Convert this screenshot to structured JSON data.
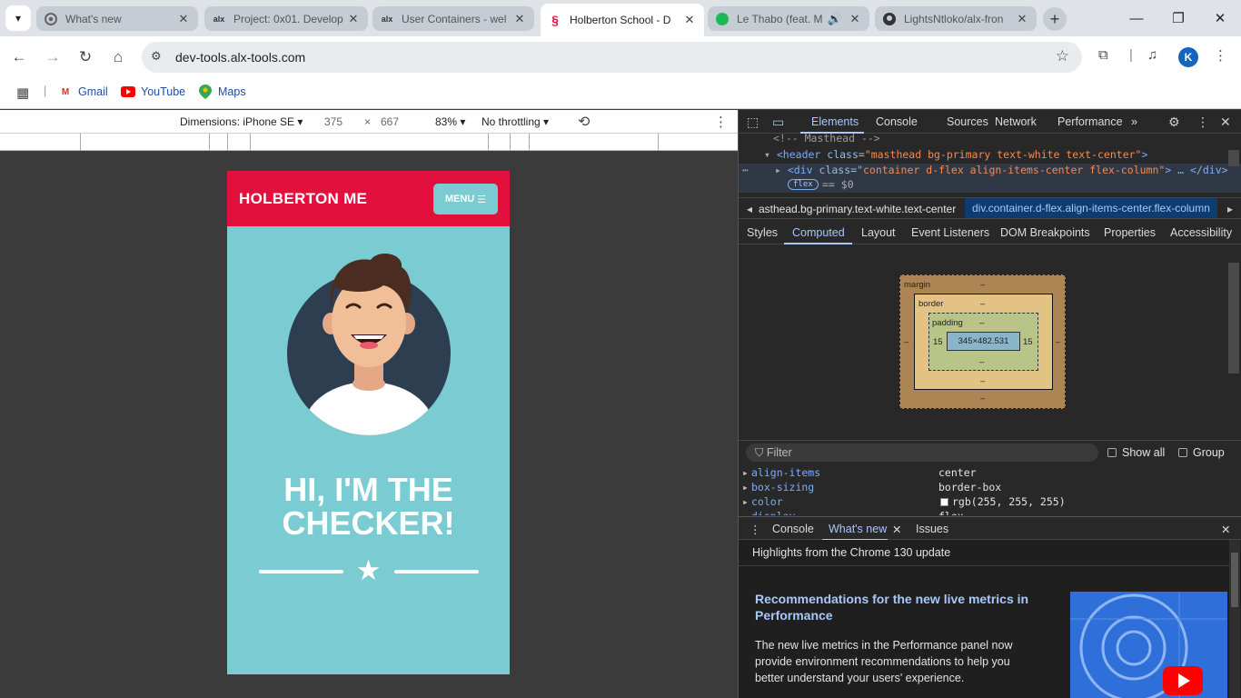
{
  "browser": {
    "tabs": [
      {
        "title": "What's new",
        "favicon": "chrome-icon",
        "active": false
      },
      {
        "title": "Project: 0x01. Develop",
        "favicon": "alx-icon",
        "active": false
      },
      {
        "title": "User Containers - wel",
        "favicon": "alx-icon",
        "active": false
      },
      {
        "title": "Holberton School - D",
        "favicon": "holberton-icon",
        "active": true
      },
      {
        "title": "Le Thabo (feat. M",
        "favicon": "spotify-icon",
        "active": false
      },
      {
        "title": "LightsNtloko/alx-fron",
        "favicon": "github-icon",
        "active": false
      }
    ],
    "close_glyph": "✕",
    "new_tab_glyph": "+",
    "url": "dev-tools.alx-tools.com",
    "bookmarks": [
      {
        "label": "Gmail",
        "icon": "gmail-icon"
      },
      {
        "label": "YouTube",
        "icon": "youtube-icon"
      },
      {
        "label": "Maps",
        "icon": "maps-icon"
      }
    ],
    "profile_initial": "K"
  },
  "device_toolbar": {
    "dimensions_label": "Dimensions: iPhone SE",
    "width": "375",
    "times": "×",
    "height": "667",
    "zoom": "83%",
    "throttling": "No throttling"
  },
  "page": {
    "brand": "HOLBERTON ME",
    "menu_label": "MENU",
    "hero_line1": "HI, I'M THE",
    "hero_line2": "CHECKER!",
    "colors": {
      "primary": "#e3103e",
      "secondary": "#7acbd2"
    }
  },
  "devtools": {
    "tabs": [
      "Elements",
      "Console",
      "Sources",
      "Network",
      "Performance"
    ],
    "active_tab": "Elements",
    "more_tabs_glyph": "»",
    "code": {
      "comment": "<!-- Masthead -->",
      "header_tag": "<header",
      "header_attr": "class=",
      "header_val": "\"masthead bg-primary text-white text-center\"",
      "header_close": ">",
      "div_tag": "<div",
      "div_attr": "class=",
      "div_val": "\"container d-flex align-items-center flex-column\"",
      "div_close": "> … </div>",
      "flex_badge": "flex",
      "dollar": "== $0"
    },
    "breadcrumbs": [
      "asthead.bg-primary.text-white.text-center",
      "div.container.d-flex.align-items-center.flex-column"
    ],
    "subtabs": [
      "Styles",
      "Computed",
      "Layout",
      "Event Listeners",
      "DOM Breakpoints",
      "Properties",
      "Accessibility"
    ],
    "active_subtab": "Computed",
    "box_model": {
      "margin_label": "margin",
      "border_label": "border",
      "padding_label": "padding",
      "dash": "–",
      "padding_left": "15",
      "padding_right": "15",
      "content_size": "345×482.531"
    },
    "filter_placeholder": "Filter",
    "show_all_label": "Show all",
    "group_label": "Group",
    "computed": [
      {
        "name": "align-items",
        "value": "center"
      },
      {
        "name": "box-sizing",
        "value": "border-box"
      },
      {
        "name": "color",
        "value": "rgb(255, 255, 255)"
      },
      {
        "name": "display",
        "value": "flex"
      }
    ],
    "drawer_tabs": [
      "Console",
      "What's new",
      "Issues"
    ],
    "active_drawer_tab": "What's new",
    "whats_new": {
      "header": "Highlights from the Chrome 130 update",
      "title": "Recommendations for the new live metrics in Performance",
      "body": "The new live metrics in the Performance panel now provide environment recommendations to help you better understand your users' experience."
    }
  }
}
